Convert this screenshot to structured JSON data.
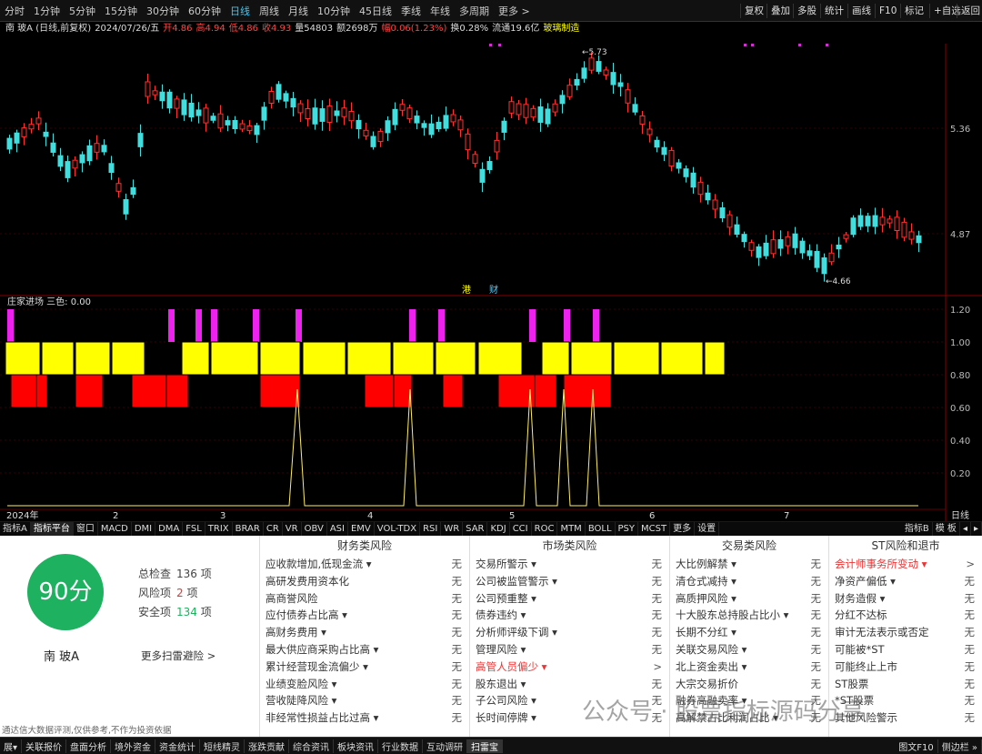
{
  "periods": [
    "分时",
    "1分钟",
    "5分钟",
    "15分钟",
    "30分钟",
    "60分钟",
    "日线",
    "周线",
    "月线",
    "10分钟",
    "45日线",
    "季线",
    "年线",
    "多周期",
    "更多 >"
  ],
  "active_period": "日线",
  "right_buttons": [
    "复权",
    "叠加",
    "多股",
    "统计",
    "画线",
    "F10",
    "标记",
    "+自选",
    "返回"
  ],
  "title": "南 玻A (日线,前复权)",
  "info_date": "2024/07/26/五",
  "info_open": "开4.86",
  "info_high": "高4.94",
  "info_low": "低4.86",
  "info_close": "收4.93",
  "info_vol": "量54803",
  "info_amt": "额2698万",
  "info_chg": "幅0.06(1.23%)",
  "info_turn": "换0.28%",
  "info_float": "流通19.6亿",
  "info_ind": "玻璃制造",
  "price_labels": [
    "5.36",
    "4.87"
  ],
  "high_mark": "5.73",
  "low_mark": "4.66",
  "sub_title": "庄家进场 三色: 0.00",
  "sub_labels": [
    "1.20",
    "1.00",
    "0.80",
    "0.60",
    "0.40",
    "0.20"
  ],
  "months": [
    "2024年",
    "2",
    "3",
    "4",
    "5",
    "6",
    "7"
  ],
  "right_label": "日线",
  "markers": [
    "港",
    "财"
  ],
  "indicators": [
    "指标A",
    "指标平台",
    "窗口",
    "MACD",
    "DMI",
    "DMA",
    "FSL",
    "TRIX",
    "BRAR",
    "CR",
    "VR",
    "OBV",
    "ASI",
    "EMV",
    "VOL-TDX",
    "RSI",
    "WR",
    "SAR",
    "KDJ",
    "CCI",
    "ROC",
    "MTM",
    "BOLL",
    "PSY",
    "MCST",
    "更多",
    "设置"
  ],
  "ind_right": [
    "指标B",
    "模 板",
    "◂",
    "▸"
  ],
  "score": "90分",
  "stock_name": "南 玻A",
  "stats": [
    {
      "label": "总检查",
      "value": "136",
      "unit": "项",
      "color": "#333"
    },
    {
      "label": "风险项",
      "value": "2",
      "unit": "项",
      "color": "#e33"
    },
    {
      "label": "安全项",
      "value": "134",
      "unit": "项",
      "color": "#1eb15f"
    }
  ],
  "more_link": "更多扫雷避险 >",
  "disclaimer": "通达信大数据评测,仅供参考,不作为投资依据",
  "columns": [
    {
      "title": "财务类风险",
      "rows": [
        [
          "应收款增加,低现金流 ▾",
          "无"
        ],
        [
          "高研发费用资本化",
          "无"
        ],
        [
          "高商誉风险",
          "无"
        ],
        [
          "应付债券占比高 ▾",
          "无"
        ],
        [
          "高财务费用 ▾",
          "无"
        ],
        [
          "最大供应商采购占比高 ▾",
          "无"
        ],
        [
          "累计经营现金流偏少 ▾",
          "无"
        ],
        [
          "业绩变脸风险 ▾",
          "无"
        ],
        [
          "营收陡降风险 ▾",
          "无"
        ],
        [
          "非经常性损益占比过高 ▾",
          "无"
        ]
      ]
    },
    {
      "title": "市场类风险",
      "rows": [
        [
          "交易所警示 ▾",
          "无"
        ],
        [
          "公司被监管警示 ▾",
          "无"
        ],
        [
          "公司预重整 ▾",
          "无"
        ],
        [
          "债券违约 ▾",
          "无"
        ],
        [
          "分析师评级下调 ▾",
          "无"
        ],
        [
          "管理风险 ▾",
          "无"
        ],
        [
          "高管人员偏少 ▾",
          ">"
        ],
        [
          "股东退出 ▾",
          "无"
        ],
        [
          "子公司风险 ▾",
          "无"
        ],
        [
          "长时间停牌 ▾",
          "无"
        ]
      ]
    },
    {
      "title": "交易类风险",
      "rows": [
        [
          "大比例解禁 ▾",
          "无"
        ],
        [
          "清仓式减持 ▾",
          "无"
        ],
        [
          "高质押风险 ▾",
          "无"
        ],
        [
          "十大股东总持股占比小 ▾",
          "无"
        ],
        [
          "长期不分红 ▾",
          "无"
        ],
        [
          "关联交易风险 ▾",
          "无"
        ],
        [
          "北上资金卖出 ▾",
          "无"
        ],
        [
          "大宗交易折价",
          "无"
        ],
        [
          "融券高融卖率 ▾",
          "无"
        ],
        [
          "高解禁占比利润占比 ▾",
          "无"
        ]
      ]
    },
    {
      "title": "ST风险和退市",
      "rows": [
        [
          "会计师事务所变动 ▾",
          ">"
        ],
        [
          "净资产偏低 ▾",
          "无"
        ],
        [
          "财务造假 ▾",
          "无"
        ],
        [
          "分红不达标",
          "无"
        ],
        [
          "审计无法表示或否定",
          "无"
        ],
        [
          "可能被*ST",
          "无"
        ],
        [
          "可能终止上市",
          "无"
        ],
        [
          "ST股票",
          "无"
        ],
        [
          "*ST股票",
          "无"
        ],
        [
          "其他风险警示",
          "无"
        ]
      ]
    }
  ],
  "red_rows": [
    [
      1,
      6
    ],
    [
      3,
      0
    ]
  ],
  "bottom_tabs": [
    "展▾",
    "关联报价",
    "盘面分析",
    "境外资金",
    "资金统计",
    "短线精灵",
    "涨跌贡献",
    "综合资讯",
    "板块资讯",
    "行业数据",
    "互动调研",
    "扫雷宝"
  ],
  "bottom_right": [
    "图文F10",
    "侧边栏 »"
  ],
  "watermark": "公众号 · 股票指标源码分享"
}
